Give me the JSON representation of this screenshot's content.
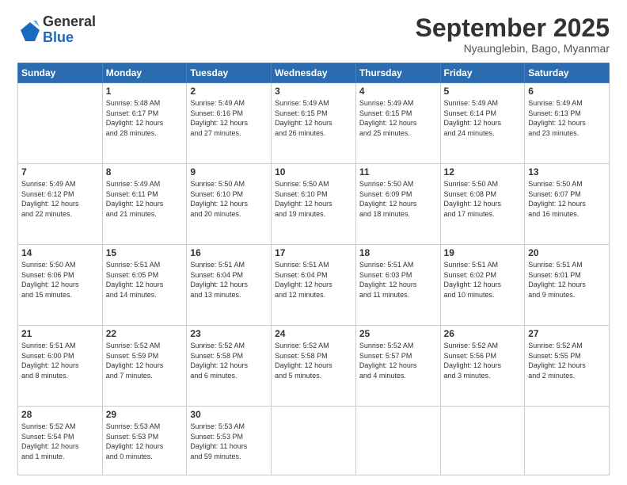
{
  "logo": {
    "general": "General",
    "blue": "Blue"
  },
  "header": {
    "month": "September 2025",
    "location": "Nyaunglebin, Bago, Myanmar"
  },
  "weekdays": [
    "Sunday",
    "Monday",
    "Tuesday",
    "Wednesday",
    "Thursday",
    "Friday",
    "Saturday"
  ],
  "weeks": [
    [
      {
        "day": "",
        "info": ""
      },
      {
        "day": "1",
        "info": "Sunrise: 5:48 AM\nSunset: 6:17 PM\nDaylight: 12 hours\nand 28 minutes."
      },
      {
        "day": "2",
        "info": "Sunrise: 5:49 AM\nSunset: 6:16 PM\nDaylight: 12 hours\nand 27 minutes."
      },
      {
        "day": "3",
        "info": "Sunrise: 5:49 AM\nSunset: 6:15 PM\nDaylight: 12 hours\nand 26 minutes."
      },
      {
        "day": "4",
        "info": "Sunrise: 5:49 AM\nSunset: 6:15 PM\nDaylight: 12 hours\nand 25 minutes."
      },
      {
        "day": "5",
        "info": "Sunrise: 5:49 AM\nSunset: 6:14 PM\nDaylight: 12 hours\nand 24 minutes."
      },
      {
        "day": "6",
        "info": "Sunrise: 5:49 AM\nSunset: 6:13 PM\nDaylight: 12 hours\nand 23 minutes."
      }
    ],
    [
      {
        "day": "7",
        "info": "Sunrise: 5:49 AM\nSunset: 6:12 PM\nDaylight: 12 hours\nand 22 minutes."
      },
      {
        "day": "8",
        "info": "Sunrise: 5:49 AM\nSunset: 6:11 PM\nDaylight: 12 hours\nand 21 minutes."
      },
      {
        "day": "9",
        "info": "Sunrise: 5:50 AM\nSunset: 6:10 PM\nDaylight: 12 hours\nand 20 minutes."
      },
      {
        "day": "10",
        "info": "Sunrise: 5:50 AM\nSunset: 6:10 PM\nDaylight: 12 hours\nand 19 minutes."
      },
      {
        "day": "11",
        "info": "Sunrise: 5:50 AM\nSunset: 6:09 PM\nDaylight: 12 hours\nand 18 minutes."
      },
      {
        "day": "12",
        "info": "Sunrise: 5:50 AM\nSunset: 6:08 PM\nDaylight: 12 hours\nand 17 minutes."
      },
      {
        "day": "13",
        "info": "Sunrise: 5:50 AM\nSunset: 6:07 PM\nDaylight: 12 hours\nand 16 minutes."
      }
    ],
    [
      {
        "day": "14",
        "info": "Sunrise: 5:50 AM\nSunset: 6:06 PM\nDaylight: 12 hours\nand 15 minutes."
      },
      {
        "day": "15",
        "info": "Sunrise: 5:51 AM\nSunset: 6:05 PM\nDaylight: 12 hours\nand 14 minutes."
      },
      {
        "day": "16",
        "info": "Sunrise: 5:51 AM\nSunset: 6:04 PM\nDaylight: 12 hours\nand 13 minutes."
      },
      {
        "day": "17",
        "info": "Sunrise: 5:51 AM\nSunset: 6:04 PM\nDaylight: 12 hours\nand 12 minutes."
      },
      {
        "day": "18",
        "info": "Sunrise: 5:51 AM\nSunset: 6:03 PM\nDaylight: 12 hours\nand 11 minutes."
      },
      {
        "day": "19",
        "info": "Sunrise: 5:51 AM\nSunset: 6:02 PM\nDaylight: 12 hours\nand 10 minutes."
      },
      {
        "day": "20",
        "info": "Sunrise: 5:51 AM\nSunset: 6:01 PM\nDaylight: 12 hours\nand 9 minutes."
      }
    ],
    [
      {
        "day": "21",
        "info": "Sunrise: 5:51 AM\nSunset: 6:00 PM\nDaylight: 12 hours\nand 8 minutes."
      },
      {
        "day": "22",
        "info": "Sunrise: 5:52 AM\nSunset: 5:59 PM\nDaylight: 12 hours\nand 7 minutes."
      },
      {
        "day": "23",
        "info": "Sunrise: 5:52 AM\nSunset: 5:58 PM\nDaylight: 12 hours\nand 6 minutes."
      },
      {
        "day": "24",
        "info": "Sunrise: 5:52 AM\nSunset: 5:58 PM\nDaylight: 12 hours\nand 5 minutes."
      },
      {
        "day": "25",
        "info": "Sunrise: 5:52 AM\nSunset: 5:57 PM\nDaylight: 12 hours\nand 4 minutes."
      },
      {
        "day": "26",
        "info": "Sunrise: 5:52 AM\nSunset: 5:56 PM\nDaylight: 12 hours\nand 3 minutes."
      },
      {
        "day": "27",
        "info": "Sunrise: 5:52 AM\nSunset: 5:55 PM\nDaylight: 12 hours\nand 2 minutes."
      }
    ],
    [
      {
        "day": "28",
        "info": "Sunrise: 5:52 AM\nSunset: 5:54 PM\nDaylight: 12 hours\nand 1 minute."
      },
      {
        "day": "29",
        "info": "Sunrise: 5:53 AM\nSunset: 5:53 PM\nDaylight: 12 hours\nand 0 minutes."
      },
      {
        "day": "30",
        "info": "Sunrise: 5:53 AM\nSunset: 5:53 PM\nDaylight: 11 hours\nand 59 minutes."
      },
      {
        "day": "",
        "info": ""
      },
      {
        "day": "",
        "info": ""
      },
      {
        "day": "",
        "info": ""
      },
      {
        "day": "",
        "info": ""
      }
    ]
  ]
}
